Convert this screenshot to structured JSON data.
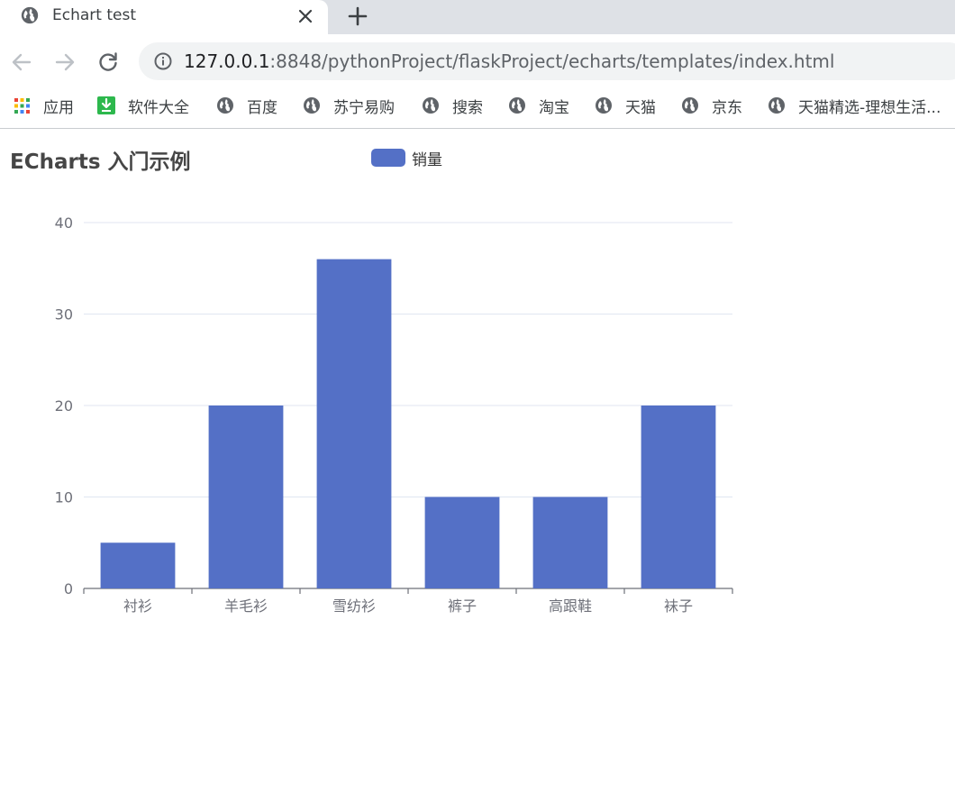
{
  "browser": {
    "tab_title": "Echart test",
    "url_host": "127.0.0.1",
    "url_rest": ":8848/pythonProject/flaskProject/echarts/templates/index.html",
    "bookmarks": [
      {
        "label": "应用",
        "icon": "apps-grid-icon"
      },
      {
        "label": "软件大全",
        "icon": "download-icon"
      },
      {
        "label": "百度",
        "icon": "globe-icon"
      },
      {
        "label": "苏宁易购",
        "icon": "globe-icon"
      },
      {
        "label": "搜索",
        "icon": "globe-icon"
      },
      {
        "label": "淘宝",
        "icon": "globe-icon"
      },
      {
        "label": "天猫",
        "icon": "globe-icon"
      },
      {
        "label": "京东",
        "icon": "globe-icon"
      },
      {
        "label": "天猫精选-理想生活...",
        "icon": "globe-icon"
      }
    ]
  },
  "chart_data": {
    "type": "bar",
    "title": "ECharts 入门示例",
    "categories": [
      "衬衫",
      "羊毛衫",
      "雪纺衫",
      "裤子",
      "高跟鞋",
      "袜子"
    ],
    "series": [
      {
        "name": "销量",
        "values": [
          5,
          20,
          36,
          10,
          10,
          20
        ]
      }
    ],
    "ylim": [
      0,
      40
    ],
    "yticks": [
      0,
      10,
      20,
      30,
      40
    ],
    "grid": true,
    "legend_position": "top-center",
    "colors": {
      "bar": "#5470c6",
      "grid": "#e0e6f1",
      "axis": "#6e7079"
    }
  }
}
